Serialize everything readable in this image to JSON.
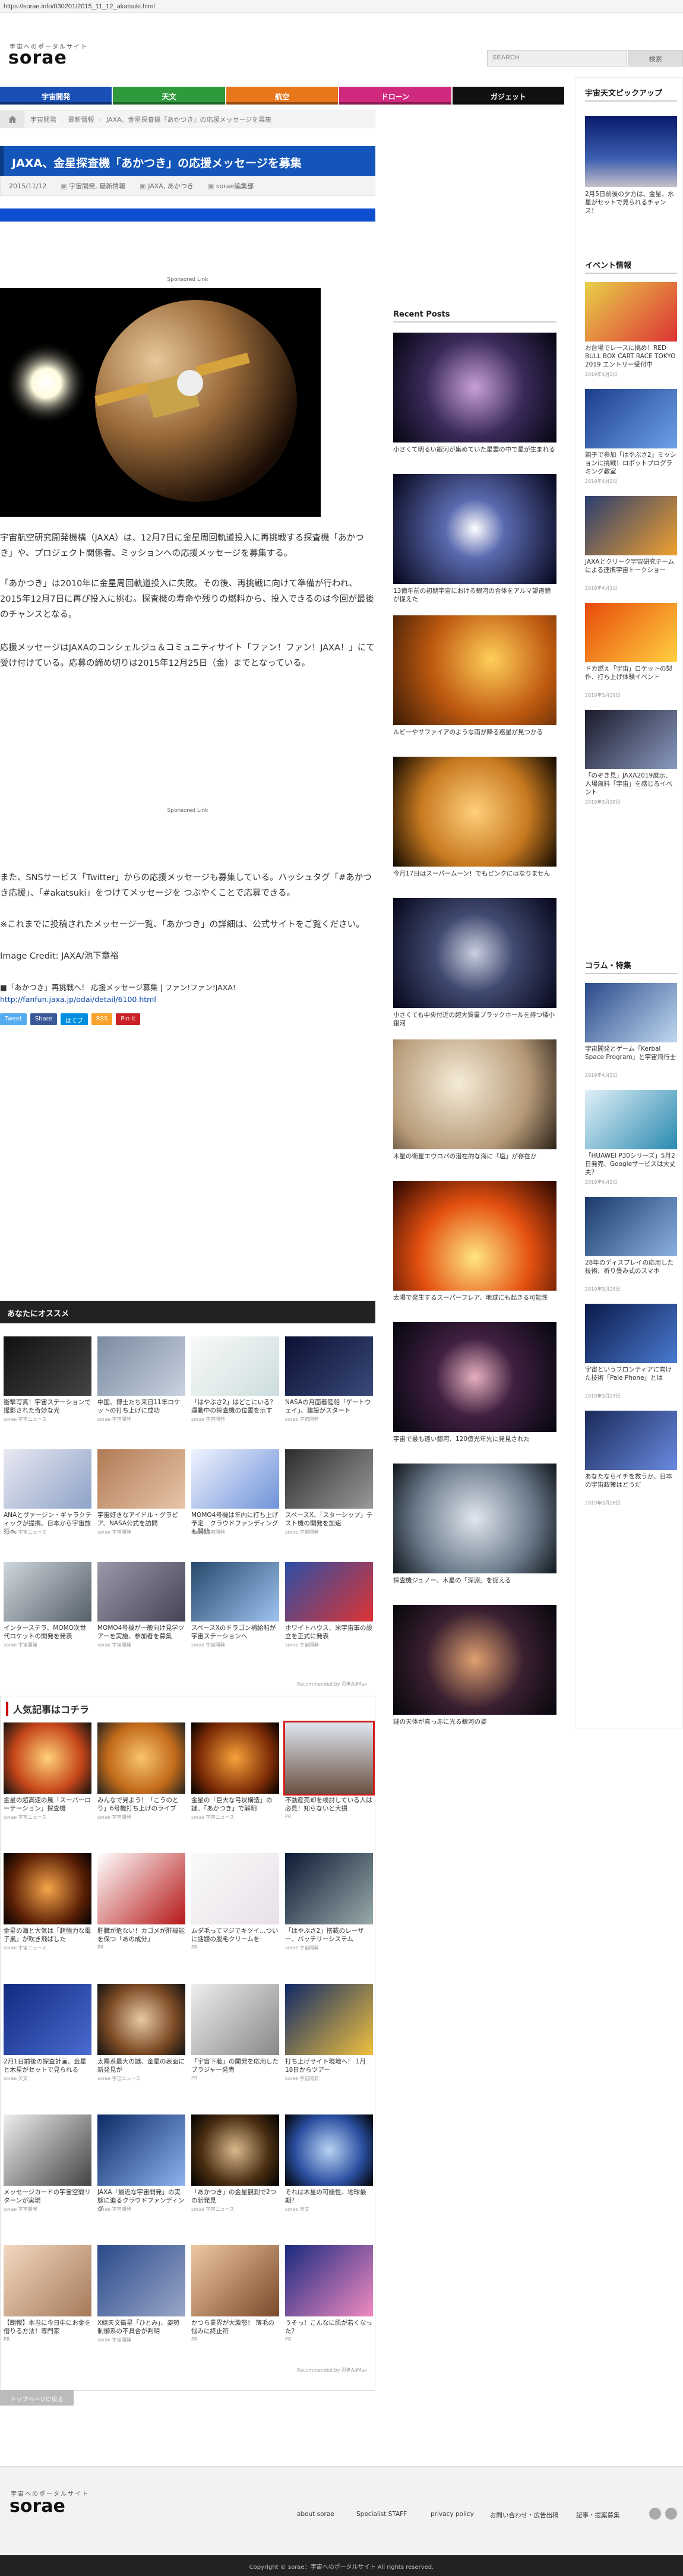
{
  "browser": {
    "url": "https://sorae.info/030201/2015_11_12_akatsuki.html"
  },
  "header": {
    "logo_sub": "宇宙へのポータルサイト",
    "logo": "sorae",
    "search_placeholder": "SEARCH",
    "search_button": "検索"
  },
  "nav": [
    {
      "label": "宇宙開発",
      "color": "#1a4fb5"
    },
    {
      "label": "天文",
      "color": "#2e9a3c"
    },
    {
      "label": "航空",
      "color": "#e8761a"
    },
    {
      "label": "ドローン",
      "color": "#d02a7f"
    },
    {
      "label": "ガジェット",
      "color": "#111111"
    }
  ],
  "breadcrumb": [
    "宇宙開発",
    "最新情報",
    "JAXA、金星探査機「あかつき」の応援メッセージを募集"
  ],
  "article": {
    "title": "JAXA、金星探査機「あかつき」の応援メッセージを募集",
    "date": "2015/11/12",
    "tags": [
      "宇宙開発",
      "最新情報",
      "JAXA",
      "あかつき",
      "sorae編集部"
    ],
    "sponsored": "Sponsored Link",
    "paragraphs": [
      "宇宙航空研究開発機構（JAXA）は、12月7日に金星周回軌道投入に再挑戦する探査機「あかつき」や、プロジェクト関係者、ミッションへの応援メッセージを募集する。",
      "「あかつき」は2010年に金星周回軌道投入に失敗。その後、再挑戦に向けて準備が行われ、2015年12月7日に再び投入に挑む。探査機の寿命や残りの燃料から、投入できるのは今回が最後のチャンスとなる。",
      "応援メッセージはJAXAのコンシェルジュ＆コミュニティサイト「ファン！ファン！JAXA！」にて受け付けている。応募の締め切りは2015年12月25日（金）までとなっている。",
      "また、SNSサービス「Twitter」からの応援メッセージも募集している。ハッシュタグ「#あかつき応援」、「#akatsuki」をつけてメッセージを つぶやくことで応募できる。",
      "※これまでに投稿されたメッセージ一覧、「あかつき」の詳細は、公式サイトをご覧ください。",
      "Image Credit: JAXA/池下章裕"
    ],
    "link_label": "■「あかつき」再挑戦へ！ 応援メッセージ募集 | ファン!ファン!JAXA!",
    "link_url": "http://fanfun.jaxa.jp/odai/detail/6100.html"
  },
  "share": [
    {
      "label": "Tweet",
      "color": "#55acee"
    },
    {
      "label": "Share",
      "color": "#3b5998"
    },
    {
      "label": "はてブ",
      "color": "#008fde"
    },
    {
      "label": "RSS",
      "color": "#f8a22b"
    },
    {
      "label": "Pin it",
      "color": "#cb2027"
    }
  ],
  "recommend": {
    "title": "あなたにオススメ",
    "footer": "Recommended by 忍者AdMax",
    "items": [
      {
        "caption": "衝撃写真！宇宙ステーションで撮影された奇妙な光",
        "source": "sorae 宇宙ニュース"
      },
      {
        "caption": "中国、博士たち来日11年ロケットの打ち上げに成功",
        "source": "sorae 宇宙開発"
      },
      {
        "caption": "「はやぶさ2」はどこにいる？ 運動中の探査機の位置を示す",
        "source": "sorae 宇宙開発"
      },
      {
        "caption": "NASAの月面着陸船「ゲートウェイ」、建設がスタート",
        "source": "sorae 宇宙開発"
      },
      {
        "caption": "ANAとヴァージン・ギャラクティックが提携、日本から宇宙旅行へ",
        "source": "sorae 宇宙ニュース"
      },
      {
        "caption": "宇宙好きなアイドル・グラビア、NASA公式を訪問",
        "source": "sorae 宇宙開発"
      },
      {
        "caption": "MOMO4号機は年内に打ち上げ予定　クラウドファンディングも開始",
        "source": "sorae 宇宙開発"
      },
      {
        "caption": "スペースX、「スターシップ」テスト機の開発を加速",
        "source": "sorae 宇宙開発"
      },
      {
        "caption": "インターステラ、MOMO次世代ロケットの開発を発表",
        "source": "sorae 宇宙開発"
      },
      {
        "caption": "MOMO4号機が一般向け見学ツアーを実施、参加者を募集",
        "source": "sorae 宇宙開発"
      },
      {
        "caption": "スペースXのドラゴン補給船が宇宙ステーションへ",
        "source": "sorae 宇宙開発"
      },
      {
        "caption": "ホワイトハウス、米宇宙軍の設立を正式に発表",
        "source": "sorae 宇宙開発"
      }
    ]
  },
  "popular": {
    "title": "人気記事はコチラ",
    "footer": "Recommended by 忍者AdMax",
    "items": [
      {
        "caption": "金星の超高速の風「スーパーローテーション」探査機",
        "source": "sorae 宇宙ニュース"
      },
      {
        "caption": "みんなで見よう！「こうのとり」6号機打ち上げのライブ",
        "source": "sorae 宇宙開発"
      },
      {
        "caption": "金星の「巨大な弓状構造」の謎、「あかつき」で解明",
        "source": "sorae 宇宙ニュース"
      },
      {
        "caption": "不動産売却を検討している人は必見！知らないと大損",
        "source": "PR"
      },
      {
        "caption": "金星の海と大気は「超強力な電子風」が吹き飛ばした",
        "source": "sorae 宇宙ニュース"
      },
      {
        "caption": "肝臓が危ない！カゴメが肝機能を保つ「あの成分」",
        "source": "PR"
      },
      {
        "caption": "ムダ毛ってマジでキツイ…ついに話題の脱毛クリームを",
        "source": "PR"
      },
      {
        "caption": "「はやぶさ2」搭載のレーザー、バッテリーシステム",
        "source": "sorae 宇宙開発"
      },
      {
        "caption": "2月1日前後の探査計画、金星と木星がセットで見られる",
        "source": "sorae 天文"
      },
      {
        "caption": "太陽系最大の謎、金星の表面に新発見が",
        "source": "sorae 宇宙ニュース"
      },
      {
        "caption": "「宇宙下着」の開発を応用したブラジャー発売",
        "source": "PR"
      },
      {
        "caption": "打ち上げサイト現地へ！ 1月18日からツアー",
        "source": "sorae 宇宙開発"
      },
      {
        "caption": "メッセージカードの宇宙空間リターンが実現",
        "source": "sorae 宇宙開発"
      },
      {
        "caption": "JAXA「最近な宇宙開発」の実態に迫るクラウドファンディング",
        "source": "sorae 宇宙開発"
      },
      {
        "caption": "「あかつき」の金星観測で2つの新発見",
        "source": "sorae 宇宙ニュース"
      },
      {
        "caption": "それは木星の可能性、地球最期？",
        "source": "sorae 天文"
      },
      {
        "caption": "【朗報】本当に今日中にお金を借りる方法！専門家",
        "source": "PR"
      },
      {
        "caption": "X線天文衛星「ひとみ」、姿勢制御系の不具合が判明",
        "source": "sorae 宇宙開発"
      },
      {
        "caption": "かつら業界が大激怒！ 薄毛の悩みに終止符",
        "source": "PR"
      },
      {
        "caption": "うそっ！こんなに肌が若くなった？",
        "source": "PR"
      }
    ]
  },
  "toppage": "トップページに戻る",
  "sidebar": {
    "pickup_title": "宇宙天文ピックアップ",
    "pickup": {
      "caption": "2月5日前後の夕方は、金星、水星がセットで見られるチャンス！"
    },
    "events_title": "イベント情報",
    "events": [
      {
        "caption": "お台場でレースに挑め！RED BULL BOX CART RACE TOKYO 2019 エントリー受付中",
        "date": "2019年4月3日"
      },
      {
        "caption": "親子で参加「はやぶさ2」ミッションに挑戦！ロボットプログラミング教室",
        "date": "2019年4月2日"
      },
      {
        "caption": "JAXAとクリーク宇宙研究チームによる連携宇宙トークショー",
        "date": "2019年4月1日"
      },
      {
        "caption": "ドカ燃え「宇宙」ロケットの製作、打ち上げ体験イベント",
        "date": "2019年3月29日"
      },
      {
        "caption": "「のぞき見」JAXA2019展示、入場無料「宇宙」を感じるイベント",
        "date": "2019年3月28日"
      }
    ],
    "column_title": "コラム・特集",
    "columns": [
      {
        "caption": "宇宙開発とゲーム「Kerbal Space Program」と宇宙飛行士",
        "date": "2019年4月3日"
      },
      {
        "caption": "「HUAWEI P30シリーズ」5月2日発売、Googleサービスは大丈夫？",
        "date": "2019年4月2日"
      },
      {
        "caption": "28年のディスプレイの応用した技術、折り畳み式のスマホ",
        "date": "2019年3月28日"
      },
      {
        "caption": "宇宙というフロンティアに向けた技術「Pale Phone」とは",
        "date": "2019年3月27日"
      },
      {
        "caption": "あなたならイチを救うか、日本の宇宙政策はどうだ",
        "date": "2019年3月26日"
      }
    ]
  },
  "recent": {
    "title": "Recent Posts",
    "items": [
      {
        "caption": "小さくて明るい銀河が集めていた星雲の中で星が生まれる"
      },
      {
        "caption": "13億年前の初期宇宙における銀河の合体をアルマ望遠鏡が捉えた"
      },
      {
        "caption": "ルビーやサファイアのような雨が降る惑星が見つかる"
      },
      {
        "caption": "今月17日はスーパームーン！でもピンクにはなりません"
      },
      {
        "caption": "小さくても中央付近の超大質量ブラックホールを持つ矮小銀河"
      },
      {
        "caption": "木星の衛星エウロパの潜在的な海に「塩」が存在か"
      },
      {
        "caption": "太陽で発生するスーパーフレア、地球にも起きる可能性"
      },
      {
        "caption": "宇宙で最も遠い銀河、120億光年先に発見された"
      },
      {
        "caption": "探査機ジュノー、木星の「深淵」を捉える"
      },
      {
        "caption": "謎の天体が真っ赤に光る銀河の姿"
      }
    ]
  },
  "footer": {
    "logo_sub": "宇宙へのポータルサイト",
    "logo": "sorae",
    "links": [
      "about sorae",
      "Specialist STAFF",
      "privacy policy",
      "お問い合わせ・広告出稿",
      "記事・提案募集"
    ],
    "copyright": "Copyright © sorae：宇宙へのポータルサイト All rights reserved."
  }
}
